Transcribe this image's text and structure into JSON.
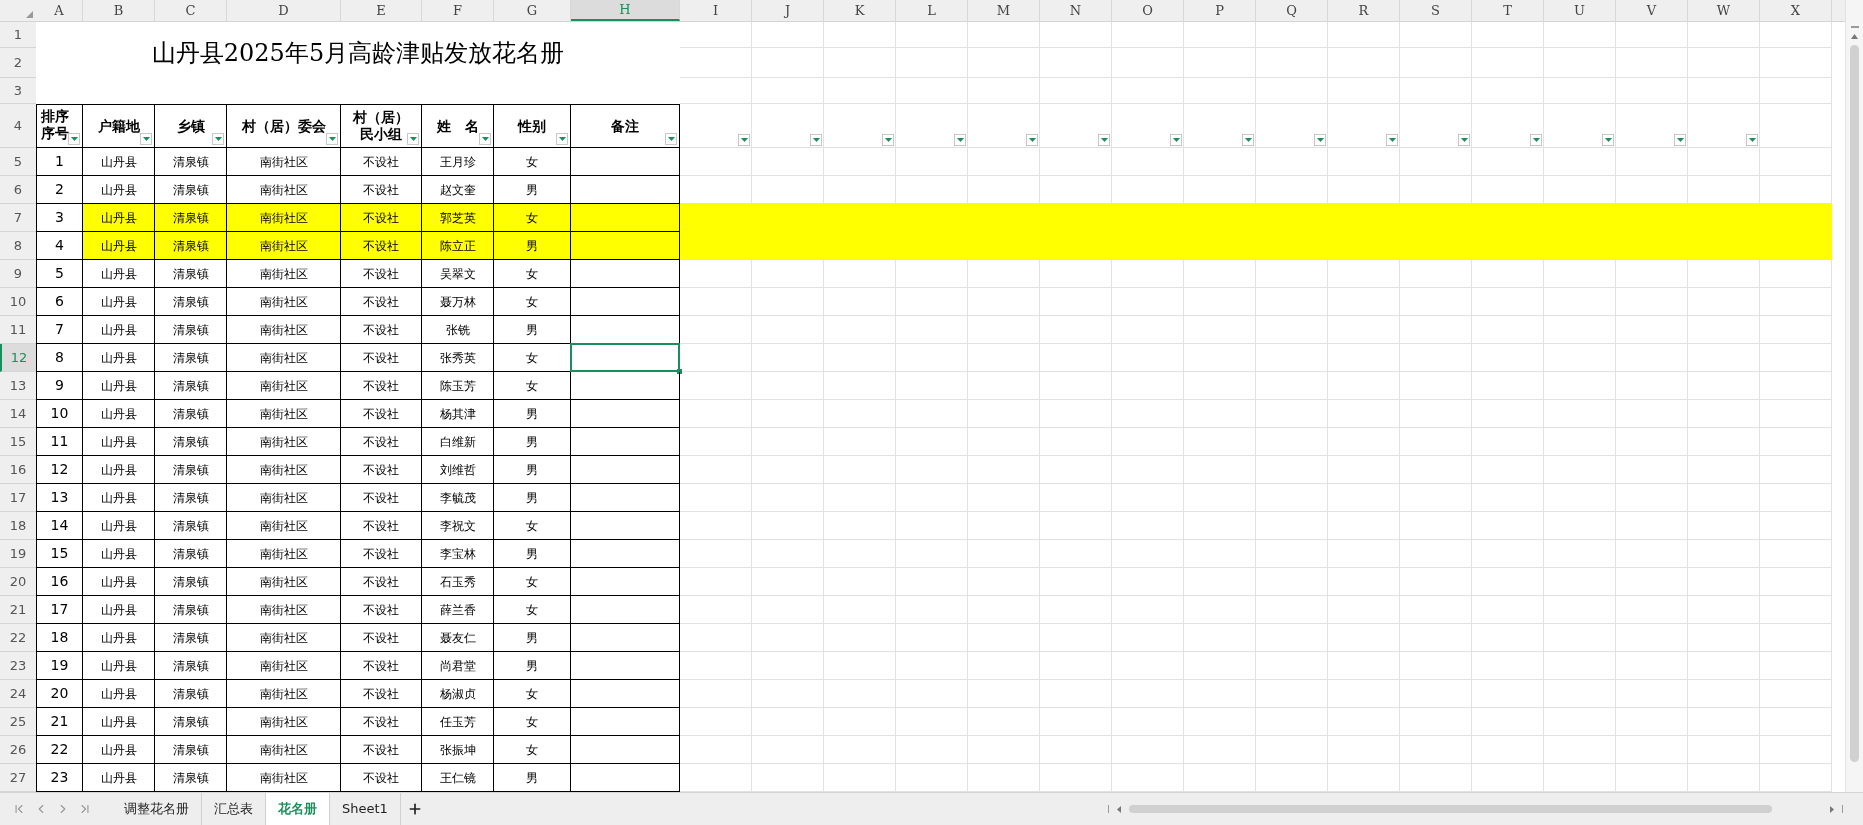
{
  "title": "山丹县2025年5月高龄津贴发放花名册",
  "columns": [
    {
      "letter": "A",
      "selected": false,
      "filter": true
    },
    {
      "letter": "B",
      "selected": false,
      "filter": true
    },
    {
      "letter": "C",
      "selected": false,
      "filter": true
    },
    {
      "letter": "D",
      "selected": false,
      "filter": true
    },
    {
      "letter": "E",
      "selected": false,
      "filter": true
    },
    {
      "letter": "F",
      "selected": false,
      "filter": true
    },
    {
      "letter": "G",
      "selected": false,
      "filter": true
    },
    {
      "letter": "H",
      "selected": true,
      "filter": true
    },
    {
      "letter": "I",
      "selected": false,
      "filter": true
    },
    {
      "letter": "J",
      "selected": false,
      "filter": true
    },
    {
      "letter": "K",
      "selected": false,
      "filter": true
    },
    {
      "letter": "L",
      "selected": false,
      "filter": true
    },
    {
      "letter": "M",
      "selected": false,
      "filter": true
    },
    {
      "letter": "N",
      "selected": false,
      "filter": true
    },
    {
      "letter": "O",
      "selected": false,
      "filter": true
    },
    {
      "letter": "P",
      "selected": false,
      "filter": true
    },
    {
      "letter": "Q",
      "selected": false,
      "filter": true
    },
    {
      "letter": "R",
      "selected": false,
      "filter": true
    },
    {
      "letter": "S",
      "selected": false,
      "filter": true
    },
    {
      "letter": "T",
      "selected": false,
      "filter": true
    },
    {
      "letter": "U",
      "selected": false,
      "filter": true
    },
    {
      "letter": "V",
      "selected": false,
      "filter": true
    },
    {
      "letter": "W",
      "selected": false,
      "filter": true
    },
    {
      "letter": "X",
      "selected": false,
      "filter": false
    }
  ],
  "row_numbers": [
    {
      "label": "1",
      "selected": false
    },
    {
      "label": "2",
      "selected": false
    },
    {
      "label": "3",
      "selected": false
    },
    {
      "label": "4",
      "selected": false
    },
    {
      "label": "5",
      "selected": false
    },
    {
      "label": "6",
      "selected": false
    },
    {
      "label": "7",
      "selected": false
    },
    {
      "label": "8",
      "selected": false
    },
    {
      "label": "9",
      "selected": false
    },
    {
      "label": "10",
      "selected": false
    },
    {
      "label": "11",
      "selected": false
    },
    {
      "label": "12",
      "selected": true
    },
    {
      "label": "13",
      "selected": false
    },
    {
      "label": "14",
      "selected": false
    },
    {
      "label": "15",
      "selected": false
    },
    {
      "label": "16",
      "selected": false
    },
    {
      "label": "17",
      "selected": false
    },
    {
      "label": "18",
      "selected": false
    },
    {
      "label": "19",
      "selected": false
    },
    {
      "label": "20",
      "selected": false
    },
    {
      "label": "21",
      "selected": false
    },
    {
      "label": "22",
      "selected": false
    },
    {
      "label": "23",
      "selected": false
    },
    {
      "label": "24",
      "selected": false
    },
    {
      "label": "25",
      "selected": false
    },
    {
      "label": "26",
      "selected": false
    },
    {
      "label": "27",
      "selected": false
    }
  ],
  "headers": [
    "排序序号",
    "户籍地",
    "乡镇",
    "村（居）委会",
    "村（居）民小组",
    "姓　名",
    "性别",
    "备注"
  ],
  "rows": [
    {
      "no": "1",
      "county": "山丹县",
      "town": "清泉镇",
      "community": "南街社区",
      "group": "不设社",
      "name": "王月珍",
      "gender": "女",
      "highlighted": false
    },
    {
      "no": "2",
      "county": "山丹县",
      "town": "清泉镇",
      "community": "南街社区",
      "group": "不设社",
      "name": "赵文奎",
      "gender": "男",
      "highlighted": false
    },
    {
      "no": "3",
      "county": "山丹县",
      "town": "清泉镇",
      "community": "南街社区",
      "group": "不设社",
      "name": "郭芝英",
      "gender": "女",
      "highlighted": true
    },
    {
      "no": "4",
      "county": "山丹县",
      "town": "清泉镇",
      "community": "南街社区",
      "group": "不设社",
      "name": "陈立正",
      "gender": "男",
      "highlighted": true
    },
    {
      "no": "5",
      "county": "山丹县",
      "town": "清泉镇",
      "community": "南街社区",
      "group": "不设社",
      "name": "吴翠文",
      "gender": "女",
      "highlighted": false
    },
    {
      "no": "6",
      "county": "山丹县",
      "town": "清泉镇",
      "community": "南街社区",
      "group": "不设社",
      "name": "聂万林",
      "gender": "女",
      "highlighted": false
    },
    {
      "no": "7",
      "county": "山丹县",
      "town": "清泉镇",
      "community": "南街社区",
      "group": "不设社",
      "name": "张铣",
      "gender": "男",
      "highlighted": false
    },
    {
      "no": "8",
      "county": "山丹县",
      "town": "清泉镇",
      "community": "南街社区",
      "group": "不设社",
      "name": "张秀英",
      "gender": "女",
      "highlighted": false
    },
    {
      "no": "9",
      "county": "山丹县",
      "town": "清泉镇",
      "community": "南街社区",
      "group": "不设社",
      "name": "陈玉芳",
      "gender": "女",
      "highlighted": false
    },
    {
      "no": "10",
      "county": "山丹县",
      "town": "清泉镇",
      "community": "南街社区",
      "group": "不设社",
      "name": "杨其津",
      "gender": "男",
      "highlighted": false
    },
    {
      "no": "11",
      "county": "山丹县",
      "town": "清泉镇",
      "community": "南街社区",
      "group": "不设社",
      "name": "白维新",
      "gender": "男",
      "highlighted": false
    },
    {
      "no": "12",
      "county": "山丹县",
      "town": "清泉镇",
      "community": "南街社区",
      "group": "不设社",
      "name": "刘维哲",
      "gender": "男",
      "highlighted": false
    },
    {
      "no": "13",
      "county": "山丹县",
      "town": "清泉镇",
      "community": "南街社区",
      "group": "不设社",
      "name": "李毓茂",
      "gender": "男",
      "highlighted": false
    },
    {
      "no": "14",
      "county": "山丹县",
      "town": "清泉镇",
      "community": "南街社区",
      "group": "不设社",
      "name": "李祝文",
      "gender": "女",
      "highlighted": false
    },
    {
      "no": "15",
      "county": "山丹县",
      "town": "清泉镇",
      "community": "南街社区",
      "group": "不设社",
      "name": "李宝林",
      "gender": "男",
      "highlighted": false
    },
    {
      "no": "16",
      "county": "山丹县",
      "town": "清泉镇",
      "community": "南街社区",
      "group": "不设社",
      "name": "石玉秀",
      "gender": "女",
      "highlighted": false
    },
    {
      "no": "17",
      "county": "山丹县",
      "town": "清泉镇",
      "community": "南街社区",
      "group": "不设社",
      "name": "薛兰香",
      "gender": "女",
      "highlighted": false
    },
    {
      "no": "18",
      "county": "山丹县",
      "town": "清泉镇",
      "community": "南街社区",
      "group": "不设社",
      "name": "聂友仁",
      "gender": "男",
      "highlighted": false
    },
    {
      "no": "19",
      "county": "山丹县",
      "town": "清泉镇",
      "community": "南街社区",
      "group": "不设社",
      "name": "尚君堂",
      "gender": "男",
      "highlighted": false
    },
    {
      "no": "20",
      "county": "山丹县",
      "town": "清泉镇",
      "community": "南街社区",
      "group": "不设社",
      "name": "杨淑贞",
      "gender": "女",
      "highlighted": false
    },
    {
      "no": "21",
      "county": "山丹县",
      "town": "清泉镇",
      "community": "南街社区",
      "group": "不设社",
      "name": "任玉芳",
      "gender": "女",
      "highlighted": false
    },
    {
      "no": "22",
      "county": "山丹县",
      "town": "清泉镇",
      "community": "南街社区",
      "group": "不设社",
      "name": "张振坤",
      "gender": "女",
      "highlighted": false
    },
    {
      "no": "23",
      "county": "山丹县",
      "town": "清泉镇",
      "community": "南街社区",
      "group": "不设社",
      "name": "王仁镜",
      "gender": "男",
      "highlighted": false
    }
  ],
  "sheet_tabs": [
    {
      "label": "调整花名册",
      "selected": false
    },
    {
      "label": "汇总表",
      "selected": false
    },
    {
      "label": "花名册",
      "selected": true
    },
    {
      "label": "Sheet1",
      "selected": false
    }
  ]
}
